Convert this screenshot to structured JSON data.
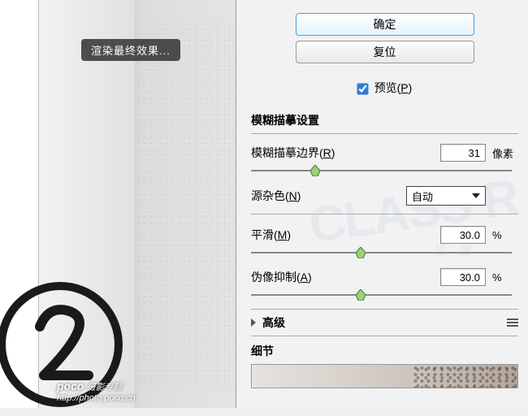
{
  "buttons": {
    "ok": "确定",
    "reset": "复位"
  },
  "preview": {
    "label": "预览",
    "hotkey": "P",
    "checked": true
  },
  "render_badge": "渲染最终效果...",
  "section_blur": {
    "title": "模糊描摹设置",
    "edge": {
      "label": "模糊描摹边界",
      "hotkey": "R",
      "value": "31",
      "unit": "像素",
      "slider_pct": 24
    },
    "noise": {
      "label": "源杂色",
      "hotkey": "N",
      "value": "自动"
    },
    "smooth": {
      "label": "平滑",
      "hotkey": "M",
      "value": "30.0",
      "unit": "%",
      "slider_pct": 41
    },
    "artifact": {
      "label": "伪像抑制",
      "hotkey": "A",
      "value": "30.0",
      "unit": "%",
      "slider_pct": 41
    }
  },
  "section_advanced": {
    "title": "高级"
  },
  "section_detail": {
    "title": "细节"
  },
  "watermark": {
    "brand": "poco",
    "sub": "摄影专题",
    "url": "http://photo.poco.cn"
  }
}
